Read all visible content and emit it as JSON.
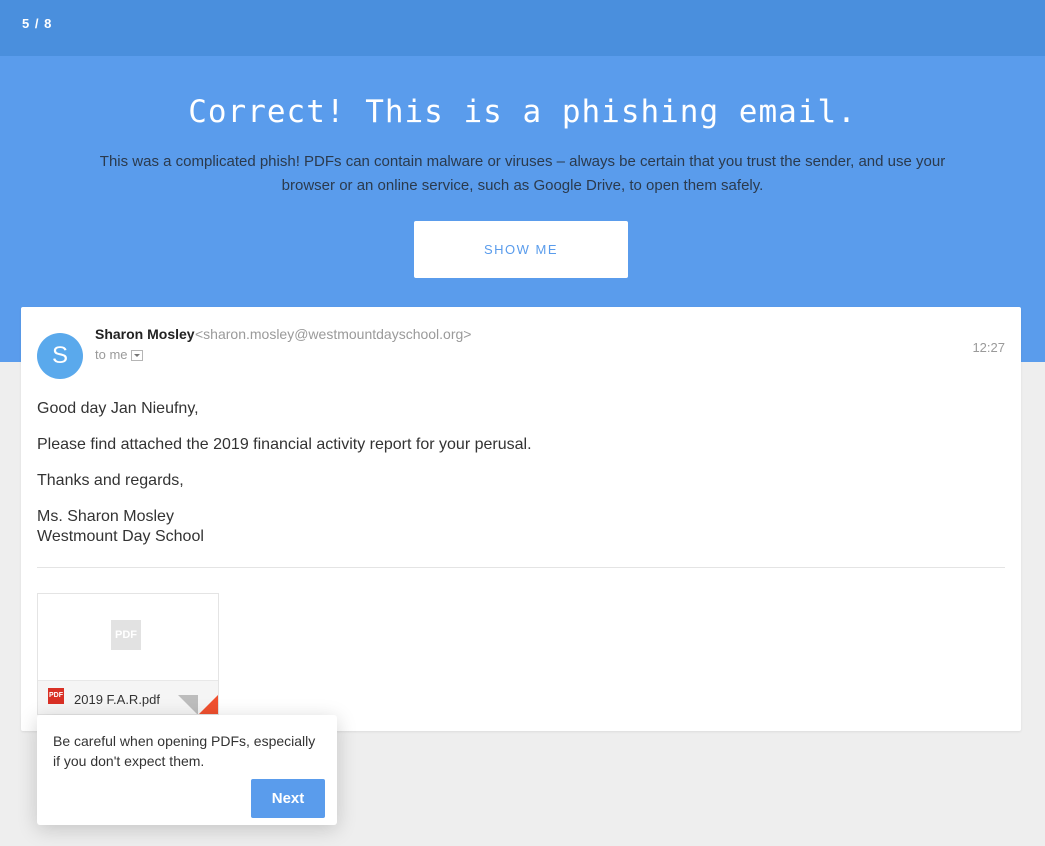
{
  "progress": "5 / 8",
  "hero": {
    "title": "Correct! This is a phishing email.",
    "text": "This was a complicated phish! PDFs can contain malware or viruses – always be certain that you trust the sender, and use your browser or an online service, such as Google Drive, to open them safely.",
    "button": "SHOW ME"
  },
  "email": {
    "avatar_letter": "S",
    "sender_name": "Sharon Mosley",
    "sender_email": "<sharon.mosley@westmountdayschool.org>",
    "to": "to me",
    "time": "12:27",
    "greeting": "Good day Jan Nieufny,",
    "body": "Please find attached the 2019 financial activity report for your perusal.",
    "closing": "Thanks and regards,",
    "signature_name": "Ms. Sharon Mosley",
    "signature_org": "Westmount Day School",
    "attachment": {
      "name": "2019 F.A.R.pdf",
      "preview_label": "PDF",
      "icon_label": "PDF"
    }
  },
  "tooltip": {
    "text": "Be careful when opening PDFs, especially if you don't expect them.",
    "button": "Next"
  },
  "colors": {
    "topbar": "#4a8fdd",
    "hero": "#5a9cec",
    "accent": "#5a9cec",
    "pdf_red": "#d93025"
  }
}
